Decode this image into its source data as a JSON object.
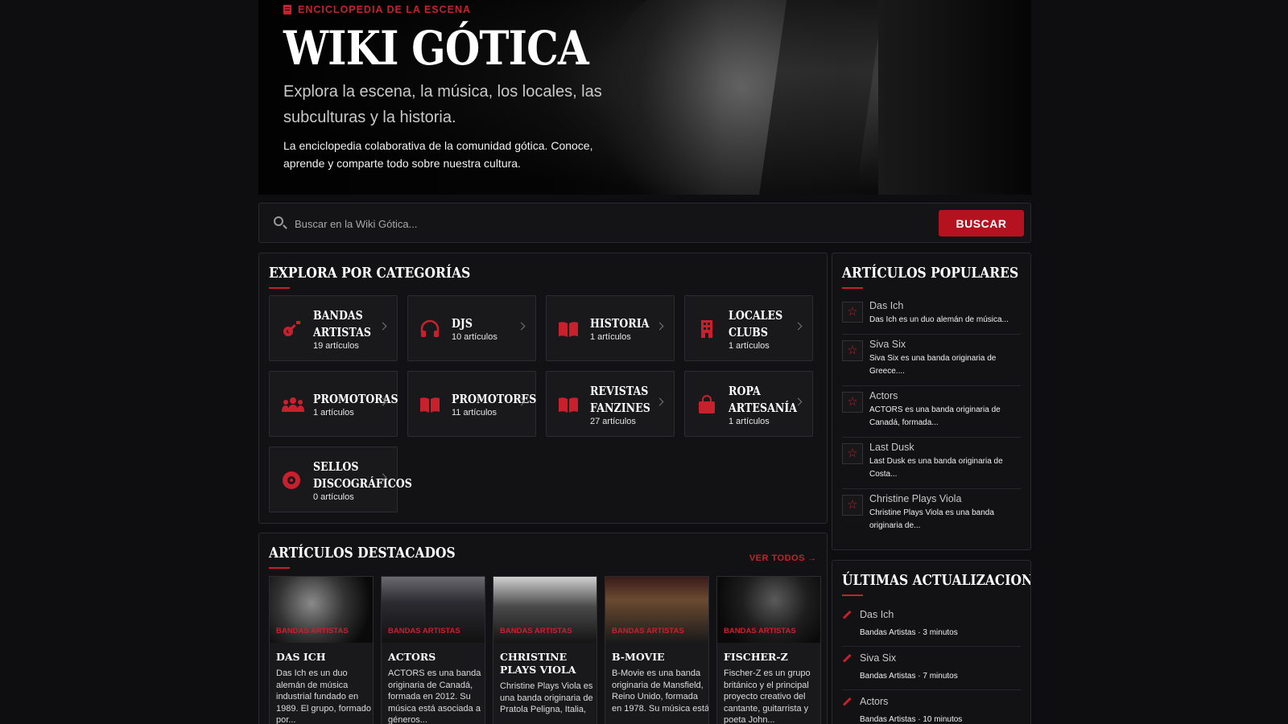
{
  "hero": {
    "eyebrow": "ENCICLOPEDIA DE LA ESCENA",
    "title": "WIKI GÓTICA",
    "subtitle": "Explora la escena, la música, los locales, las subculturas y la historia.",
    "description": "La enciclopedia colaborativa de la comunidad gótica. Conoce, aprende y comparte todo sobre nuestra cultura."
  },
  "search": {
    "placeholder": "Buscar en la Wiki Gótica...",
    "button": "BUSCAR"
  },
  "categories": {
    "title": "EXPLORA POR CATEGORÍAS",
    "items": [
      {
        "name1": "BANDAS",
        "name2": "ARTISTAS",
        "count": "19 artículos",
        "icon": "guitar-icon"
      },
      {
        "name1": "DJS",
        "name2": "",
        "count": "10 artículos",
        "icon": "headphones-icon"
      },
      {
        "name1": "HISTORIA",
        "name2": "",
        "count": "1 artículos",
        "icon": "book-icon"
      },
      {
        "name1": "LOCALES",
        "name2": "CLUBS",
        "count": "1 artículos",
        "icon": "building-icon"
      },
      {
        "name1": "PROMOTORAS",
        "name2": "",
        "count": "1 artículos",
        "icon": "users-icon"
      },
      {
        "name1": "PROMOTORES",
        "name2": "",
        "count": "11 artículos",
        "icon": "book-icon"
      },
      {
        "name1": "REVISTAS",
        "name2": "FANZINES",
        "count": "27 artículos",
        "icon": "book-icon"
      },
      {
        "name1": "ROPA",
        "name2": "ARTESANÍA",
        "count": "1 artículos",
        "icon": "bag-icon"
      },
      {
        "name1": "SELLOS",
        "name2": "DISCOGRÁFICOS",
        "count": "0 artículos",
        "icon": "record-icon"
      }
    ]
  },
  "featured": {
    "title": "ARTÍCULOS DESTACADOS",
    "see_all": "VER TODOS →",
    "items": [
      {
        "tag": "BANDAS ARTISTAS",
        "title": "DAS ICH",
        "text": "Das Ich es un duo alemán de música industrial fundado en 1989. El grupo, formado por..."
      },
      {
        "tag": "BANDAS ARTISTAS",
        "title": "ACTORS",
        "text": "ACTORS es una banda originaria de Canadá, formada en 2012. Su música está asociada a géneros..."
      },
      {
        "tag": "BANDAS ARTISTAS",
        "title": "CHRISTINE PLAYS VIOLA",
        "text": "Christine Plays Viola es una banda originaria de Pratola Peligna, Italia,"
      },
      {
        "tag": "BANDAS ARTISTAS",
        "title": "B-MOVIE",
        "text": "B-Movie es una banda originaria de Mansfield, Reino Unido, formada en 1978. Su música está"
      },
      {
        "tag": "BANDAS ARTISTAS",
        "title": "FISCHER-Z",
        "text": "Fischer-Z es un grupo británico y el principal proyecto creativo del cantante, guitarrista y poeta John..."
      }
    ]
  },
  "popular": {
    "title": "ARTÍCULOS POPULARES",
    "items": [
      {
        "title": "Das Ich",
        "desc": "Das Ich es un duo alemán de música..."
      },
      {
        "title": "Siva Six",
        "desc": "Siva Six es una banda originaria de Greece...."
      },
      {
        "title": "Actors",
        "desc": "ACTORS es una banda originaria de Canadá, formada..."
      },
      {
        "title": "Last Dusk",
        "desc": "Last Dusk es una banda originaria de Costa..."
      },
      {
        "title": "Christine Plays Viola",
        "desc": "Christine Plays Viola es una banda originaria de..."
      }
    ]
  },
  "updates": {
    "title": "ÚLTIMAS ACTUALIZACIONES",
    "items": [
      {
        "title": "Das Ich",
        "meta": "Bandas Artistas · 3 minutos"
      },
      {
        "title": "Siva Six",
        "meta": "Bandas Artistas · 7 minutos"
      },
      {
        "title": "Actors",
        "meta": "Bandas Artistas · 10 minutos"
      }
    ]
  },
  "colors": {
    "accent": "#c8202d",
    "background": "#0e0e10",
    "panel": "#121214"
  }
}
